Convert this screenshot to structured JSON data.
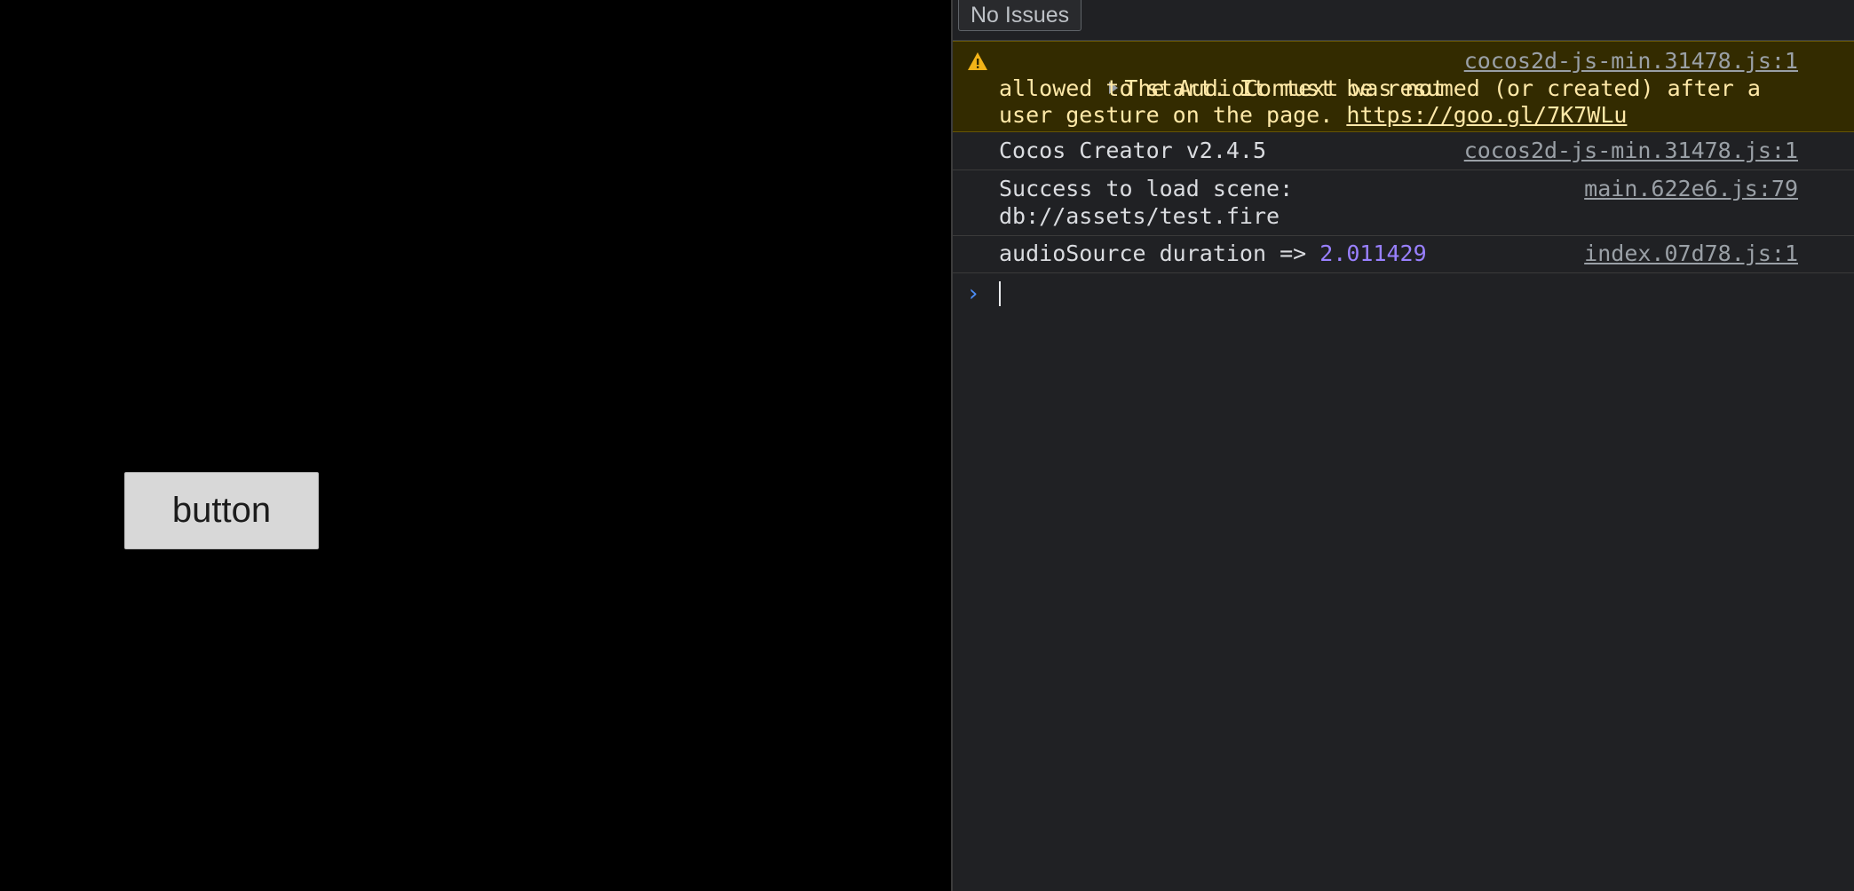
{
  "game": {
    "button_label": "button"
  },
  "devtools": {
    "issues_label": "No Issues",
    "messages": {
      "warning": {
        "line1": "The AudioContext was not",
        "line2": "allowed to start. It must be resumed (or created) after a",
        "line3_text": "user gesture on the page. ",
        "line3_link": "https://goo.gl/7K7WLu",
        "source": "cocos2d-js-min.31478.js:1"
      },
      "log1": {
        "text": "Cocos Creator v2.4.5",
        "source": "cocos2d-js-min.31478.js:1"
      },
      "log2": {
        "line1": "Success to load scene:",
        "line2": "db://assets/test.fire",
        "source": "main.622e6.js:79"
      },
      "log3": {
        "text": "audioSource duration => ",
        "value": "2.011429",
        "source": "index.07d78.js:1"
      }
    },
    "prompt_symbol": "›"
  },
  "colors": {
    "warning_bg": "#332b00",
    "warning_text": "#ffe9a8",
    "number": "#9980ff",
    "prompt": "#4b8cf5",
    "panel_bg": "#202124"
  },
  "icons": {
    "warning": "warning-triangle-icon",
    "expand": "expand-arrow-icon",
    "prompt": "chevron-right-icon"
  }
}
